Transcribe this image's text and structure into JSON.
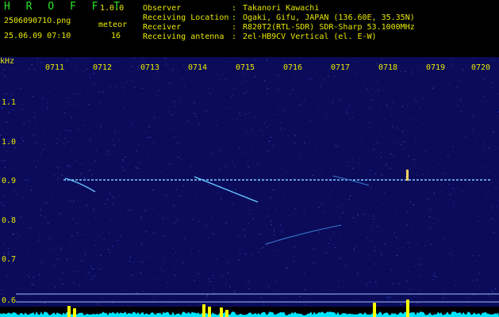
{
  "header": {
    "brand": "H R O F F T",
    "version": "1.0.0",
    "file_name": "250609071O.png",
    "datetime": "25.06.09 07:10",
    "meteor_label": "meteor",
    "meteor_count": "16",
    "info": [
      {
        "label": "Observer",
        "value": "Takanori Kawachi"
      },
      {
        "label": "Receiving Location",
        "value": "Ogaki, Gifu, JAPAN (136.60E, 35.35N)"
      },
      {
        "label": "Receiver",
        "value": "R820T2(RTL-SDR) SDR-Sharp 53.1000MHz"
      },
      {
        "label": "Receiving antenna",
        "value": "2el-HB9CV Vertical (el. E-W)"
      }
    ],
    "separator": ":"
  },
  "axis": {
    "unit": "kHz",
    "y_ticks": [
      "1.1",
      "1.0",
      "0.9",
      "0.8",
      "0.7",
      "0.6"
    ],
    "time_ticks": [
      "0711",
      "0712",
      "0713",
      "0714",
      "0715",
      "0716",
      "0717",
      "0718",
      "0719",
      "0720"
    ]
  },
  "colors": {
    "background": "#000000",
    "spectrogram": "#0b0b5a",
    "text": "#e8e800",
    "brand": "#29e629",
    "carrier": "#7fd0ff",
    "level": "#00e5ff",
    "level_peak": "#ffff00"
  }
}
